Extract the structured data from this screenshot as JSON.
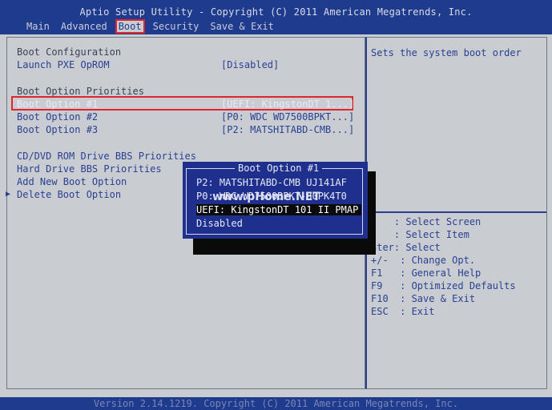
{
  "header": {
    "title": "Aptio Setup Utility - Copyright (C) 2011 American Megatrends, Inc.",
    "tabs": [
      "Main",
      "Advanced",
      "Boot",
      "Security",
      "Save & Exit"
    ]
  },
  "main": {
    "section_boot_config": "Boot Configuration",
    "launch_pxe": {
      "label": "Launch PXE OpROM",
      "value": "[Disabled]"
    },
    "section_priorities": "Boot Option Priorities",
    "boot_options": [
      {
        "label": "Boot Option #1",
        "value": "[UEFI: KingstonDT 1...]"
      },
      {
        "label": "Boot Option #2",
        "value": "[P0: WDC WD7500BPKT...]"
      },
      {
        "label": "Boot Option #3",
        "value": "[P2: MATSHITABD-CMB...]"
      }
    ],
    "cd_dvd": "CD/DVD ROM Drive BBS Priorities",
    "hdd": "Hard Drive BBS Priorities",
    "add_new": "Add New Boot Option",
    "delete": "Delete Boot Option"
  },
  "help": {
    "description": "Sets the system boot order",
    "keys": [
      "    : Select Screen",
      "    : Select Item",
      "nter: Select",
      "+/-  : Change Opt.",
      "F1   : General Help",
      "F9   : Optimized Defaults",
      "F10  : Save & Exit",
      "ESC  : Exit"
    ]
  },
  "popup": {
    "title": "Boot Option #1",
    "options": [
      "P2: MATSHITABD-CMB UJ141AF",
      "P0: WDC WD7500BPKT-80PK4T0",
      "UEFI: KingstonDT 101 II PMAP",
      "Disabled"
    ],
    "selected_index": 2
  },
  "watermark": "www.pHome.NET",
  "footer": "Version 2.14.1219. Copyright (C) 2011 American Megatrends, Inc.",
  "colors": {
    "header_bg": "#1f3b8e",
    "screen_bg": "#c9cdd2",
    "text_blue": "#2a3f92",
    "highlight_red": "#e0262d"
  }
}
